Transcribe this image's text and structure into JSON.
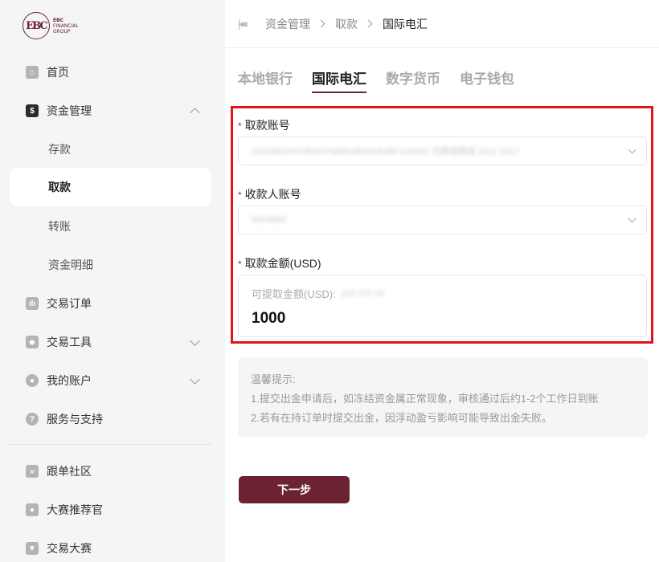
{
  "logo": {
    "mark": "EBC",
    "line1": "EBC",
    "line2": "FINANCIAL",
    "line3": "GROUP"
  },
  "sidebar": {
    "items": [
      {
        "label": "首页",
        "icon": "home-icon"
      },
      {
        "label": "资金管理",
        "icon": "dollar-wallet-icon",
        "expanded": true
      },
      {
        "label": "交易订单",
        "icon": "chart-bars-icon"
      },
      {
        "label": "交易工具",
        "icon": "cube-icon"
      },
      {
        "label": "我的账户",
        "icon": "user-icon"
      },
      {
        "label": "服务与支持",
        "icon": "question-icon"
      },
      {
        "label": "跟单社区",
        "icon": "forward-icon"
      },
      {
        "label": "大赛推荐官",
        "icon": "badge-user-icon"
      },
      {
        "label": "交易大赛",
        "icon": "trophy-icon"
      }
    ],
    "sub_items": [
      {
        "label": "存款"
      },
      {
        "label": "取款",
        "active": true
      },
      {
        "label": "转账"
      },
      {
        "label": "资金明细"
      }
    ]
  },
  "breadcrumb": [
    "资金管理",
    "取款",
    "国际电汇"
  ],
  "tabs": [
    {
      "label": "本地银行"
    },
    {
      "label": "国际电汇",
      "active": true
    },
    {
      "label": "数字货币"
    },
    {
      "label": "电子钱包"
    }
  ],
  "form": {
    "withdraw_account_label": "取款账号",
    "withdraw_account_value": "1020982AF10E9CF9abfcaB0d1AaBF1cbA01  可提现额度 2011 2317",
    "payee_account_label": "收款人账号",
    "payee_account_value": "6654800",
    "amount_label": "取款金额(USD)",
    "available_label": "可提取金额(USD):",
    "available_value": "102,707.00",
    "amount_value": "1000",
    "required_mark": "*"
  },
  "tips": {
    "title": "温馨提示:",
    "line1": "1.提交出金申请后，如冻结资金属正常现象，审核通过后约1-2个工作日到账",
    "line2": "2.若有在持订单时提交出金，因浮动盈亏影响可能导致出金失败。"
  },
  "next_button": "下一步",
  "colors": {
    "brand": "#6b2232",
    "highlight": "#e3121b"
  }
}
